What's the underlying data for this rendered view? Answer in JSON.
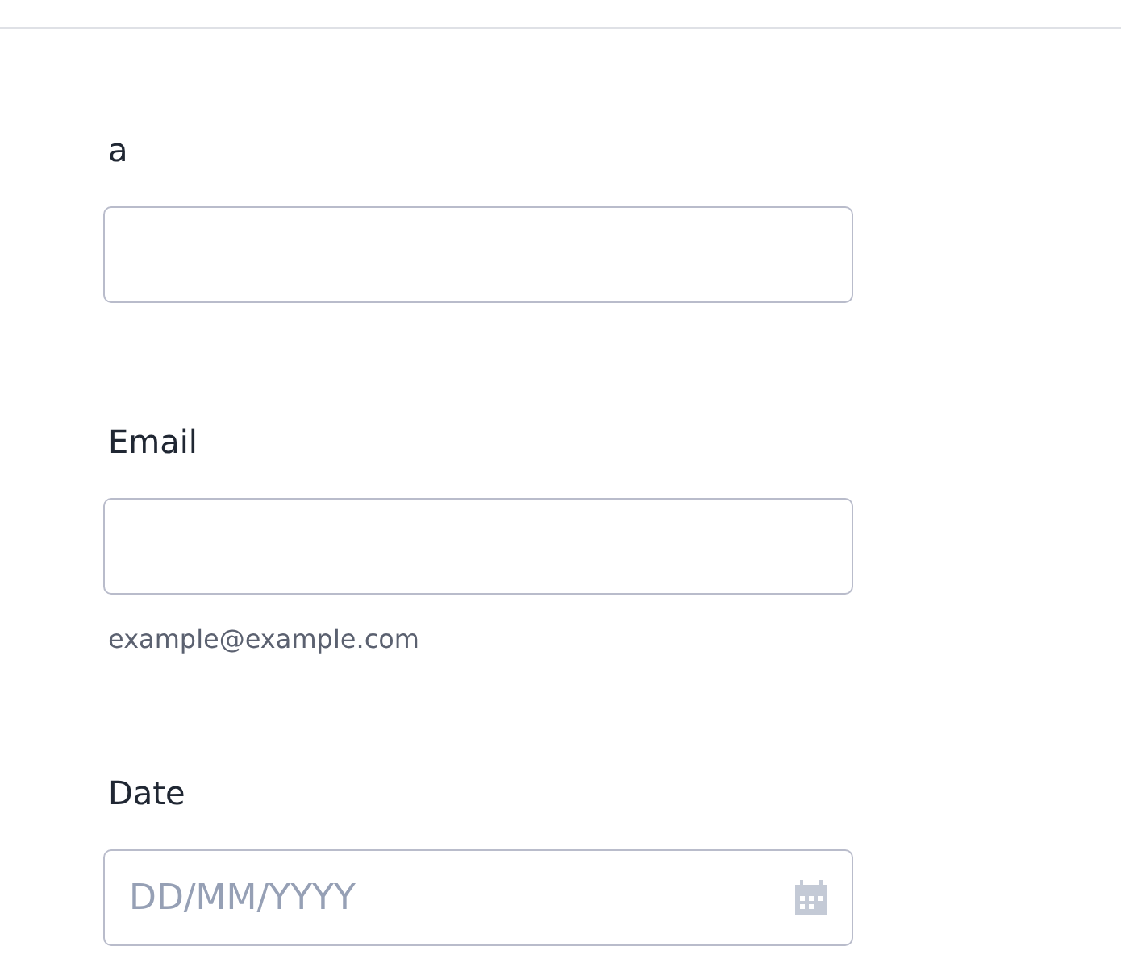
{
  "fields": [
    {
      "label": "a",
      "kind": "text"
    },
    {
      "label": "Email",
      "kind": "email",
      "hint": "example@example.com"
    },
    {
      "label": "Date",
      "kind": "date",
      "placeholder": "DD/MM/YYYY"
    }
  ]
}
